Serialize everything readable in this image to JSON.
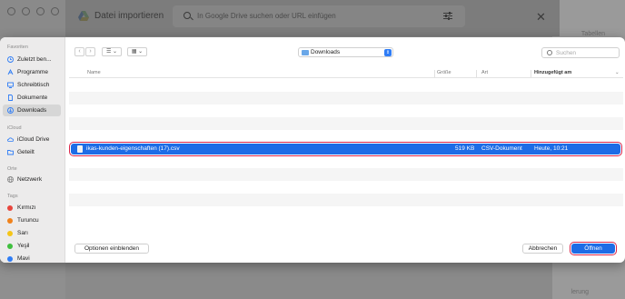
{
  "drive": {
    "title": "Datei importieren",
    "search_placeholder": "In Google Drive suchen oder URL einfügen",
    "close_label": "✕"
  },
  "background": {
    "right_labels": [
      "Tabellen",
      "lerung"
    ]
  },
  "sidebar": {
    "favorites_title": "Favoriten",
    "favorites": [
      {
        "label": "Zuletzt ben...",
        "icon": "clock-icon"
      },
      {
        "label": "Programme",
        "icon": "apps-icon"
      },
      {
        "label": "Schreibtisch",
        "icon": "desktop-icon"
      },
      {
        "label": "Dokumente",
        "icon": "document-icon"
      },
      {
        "label": "Downloads",
        "icon": "download-icon",
        "active": true
      }
    ],
    "icloud_title": "iCloud",
    "icloud": [
      {
        "label": "iCloud Drive",
        "icon": "cloud-icon"
      },
      {
        "label": "Geteilt",
        "icon": "shared-folder-icon"
      }
    ],
    "places_title": "Orte",
    "places": [
      {
        "label": "Netzwerk",
        "icon": "globe-icon"
      }
    ],
    "tags_title": "Tags",
    "tags": [
      {
        "label": "Kırmızı",
        "color": "#e8453c"
      },
      {
        "label": "Turuncu",
        "color": "#f0821c"
      },
      {
        "label": "Sarı",
        "color": "#f5c518"
      },
      {
        "label": "Yeşil",
        "color": "#3fbf3f"
      },
      {
        "label": "Mavi",
        "color": "#2f7df6"
      }
    ]
  },
  "toolbar": {
    "back": "‹",
    "forward": "›",
    "list_view": "☰ ⌄",
    "grid_view": "▦ ⌄",
    "location": "Downloads",
    "location_stepper": "⇕",
    "search_placeholder": "Suchen"
  },
  "columns": {
    "name": "Name",
    "size": "Größe",
    "kind": "Art",
    "date_added": "Hinzugefügt am",
    "sort_arrow": "⌄"
  },
  "files": [
    {
      "name": "ikas-kunden-eigenschaften (17).csv",
      "size": "519 KB",
      "kind": "CSV-Dokument",
      "date_added": "Heute, 10:21",
      "selected": true
    }
  ],
  "buttons": {
    "options": "Optionen einblenden",
    "cancel": "Abbrechen",
    "open": "Öffnen"
  },
  "colors": {
    "accent": "#1d6ce6",
    "highlight_outline": "#d9254a"
  }
}
